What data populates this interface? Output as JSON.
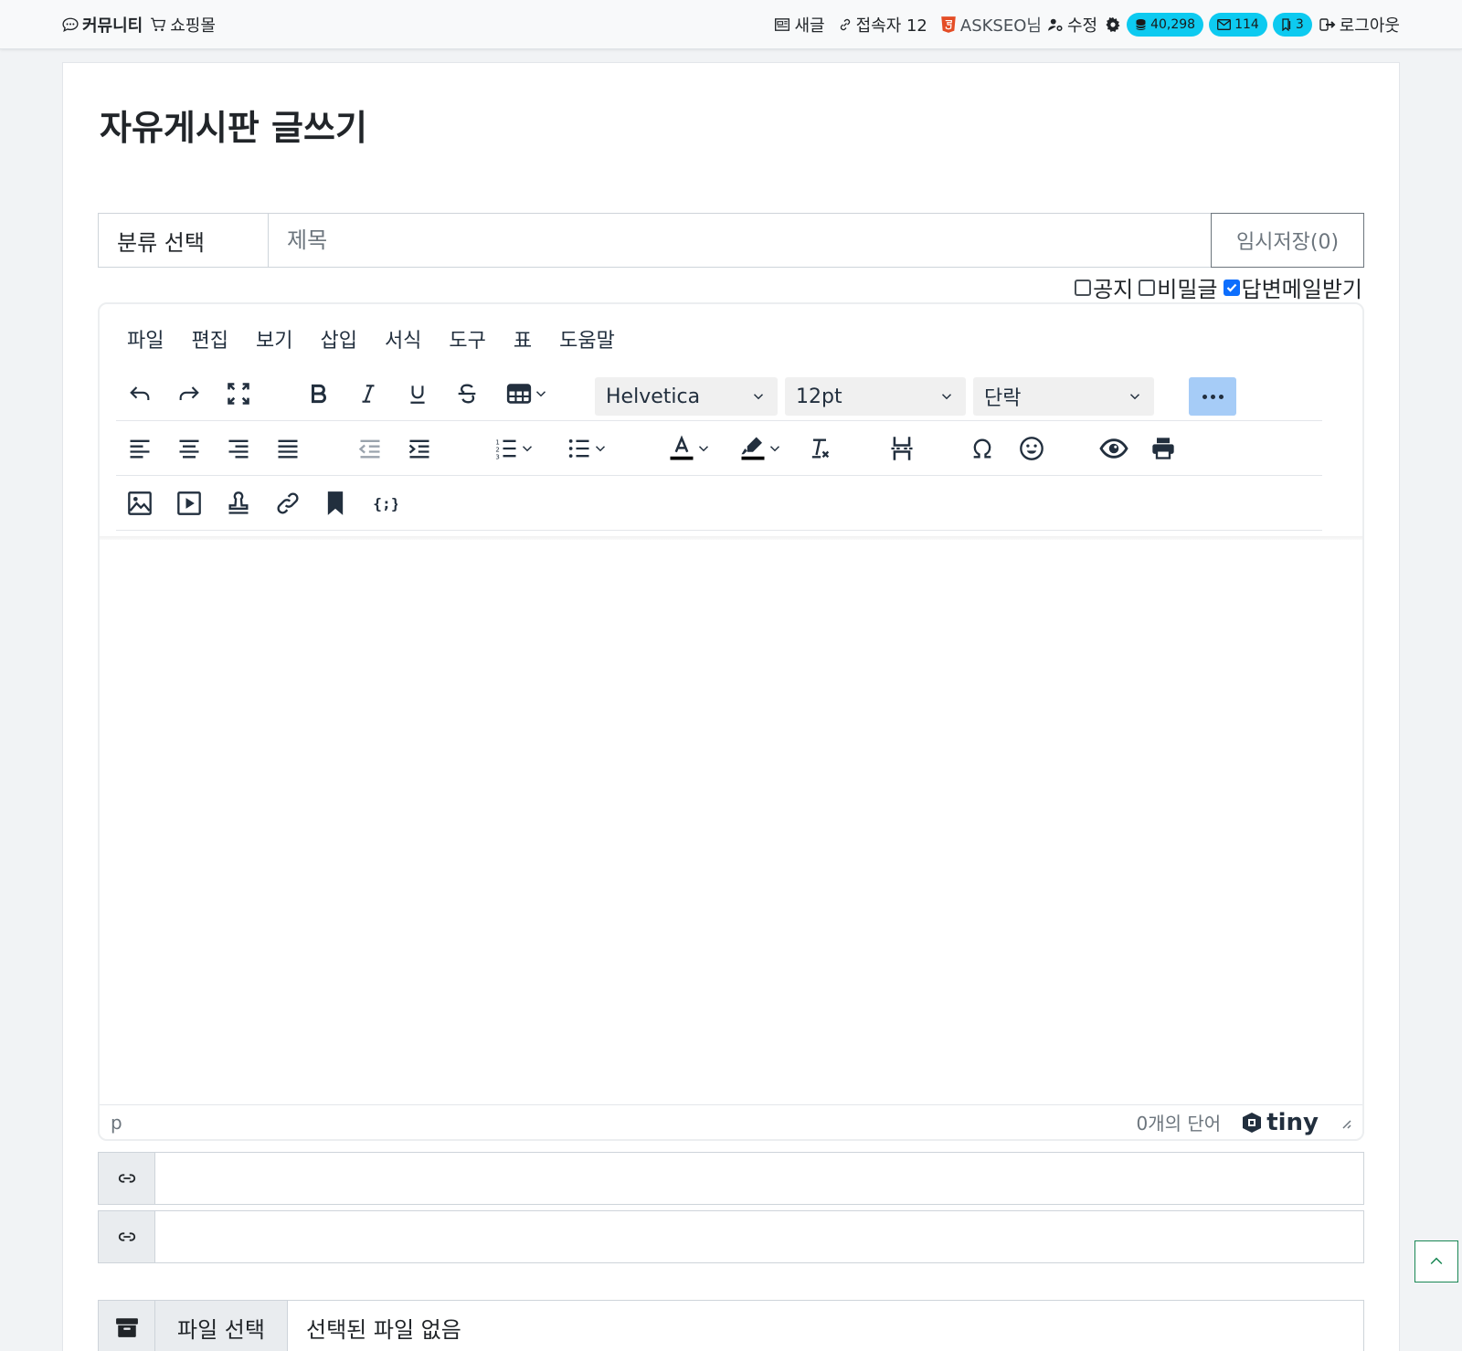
{
  "nav": {
    "community": "커뮤니티",
    "shop": "쇼핑몰",
    "new_posts": "새글",
    "visitors": "접속자 12",
    "user": "ASKSEO님",
    "edit": "수정",
    "points": "40,298",
    "messages": "114",
    "scraps": "3",
    "logout": "로그아웃"
  },
  "page": {
    "title": "자유게시판 글쓰기"
  },
  "form": {
    "category": "분류 선택",
    "subject_placeholder": "제목",
    "temp_save": "임시저장(0)",
    "options": [
      {
        "label": "공지",
        "checked": false
      },
      {
        "label": "비밀글",
        "checked": false
      },
      {
        "label": "답변메일받기",
        "checked": true
      }
    ]
  },
  "editor": {
    "menu": [
      "파일",
      "편집",
      "보기",
      "삽입",
      "서식",
      "도구",
      "표",
      "도움말"
    ],
    "font_family": "Helvetica",
    "font_size": "12pt",
    "block_format": "단락",
    "status_path": "p",
    "word_count": "0개의 단어",
    "brand": "tiny"
  },
  "file": {
    "button": "파일 선택",
    "status": "선택된 파일 없음"
  },
  "colors": {
    "badge": "#0dcaf0",
    "accent": "#0d6efd",
    "more_button": "#a6ccf7"
  }
}
